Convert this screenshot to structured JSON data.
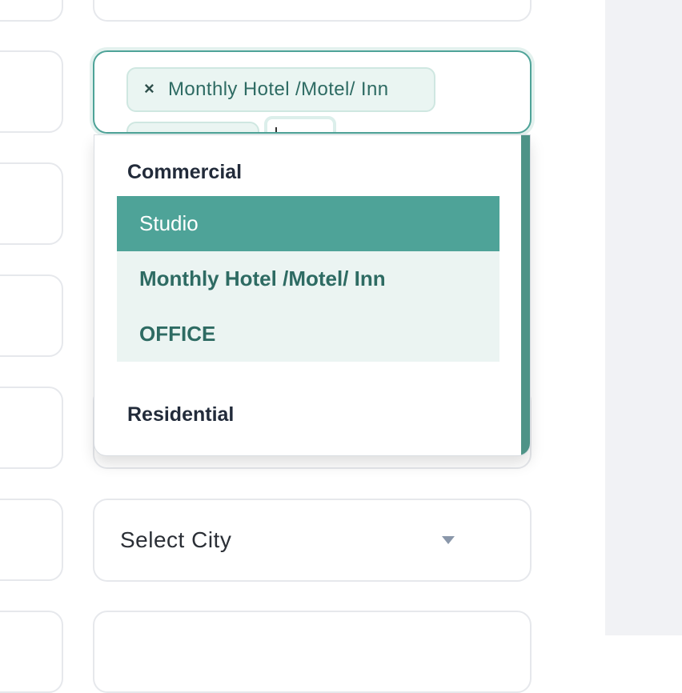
{
  "multiselect": {
    "chips": [
      {
        "label": "Monthly Hotel /Motel/ Inn",
        "remove_icon": "×"
      }
    ]
  },
  "dropdown": {
    "groups": [
      {
        "label": "Commercial",
        "options": [
          {
            "label": "Studio",
            "state": "selected"
          },
          {
            "label": "Monthly Hotel /Motel/ Inn",
            "state": "focused"
          },
          {
            "label": "OFFICE",
            "state": "focused"
          }
        ]
      },
      {
        "label": "Residential"
      }
    ]
  },
  "city_select": {
    "value": "Select City",
    "icon": "caret-down-icon"
  },
  "colors": {
    "accent": "#4ea398",
    "accent_dark": "#2e6b63",
    "chip_bg": "#eaf5f2",
    "option_focus_bg": "#ebf4f2",
    "side_panel": "#f1f2f5"
  }
}
